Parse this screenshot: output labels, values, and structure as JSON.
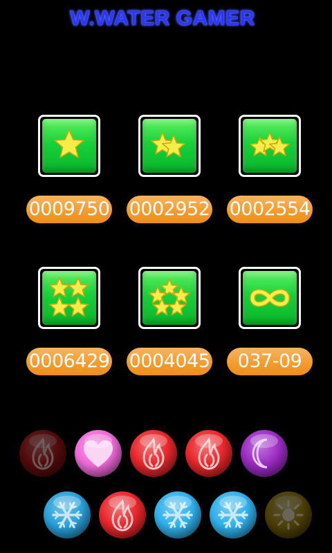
{
  "title": "W.WATER GAMER",
  "modes": [
    {
      "icon": "one-star-icon",
      "score": "0009750"
    },
    {
      "icon": "two-stars-icon",
      "score": "0002952"
    },
    {
      "icon": "three-stars-icon",
      "score": "0002554"
    },
    {
      "icon": "four-stars-icon",
      "score": "0006429"
    },
    {
      "icon": "five-stars-icon",
      "score": "0004045"
    },
    {
      "icon": "infinity-icon",
      "score": "037-09"
    }
  ],
  "elements_row_1": [
    {
      "icon": "fire-icon",
      "state": "dim",
      "color": "#b8171a"
    },
    {
      "icon": "heart-icon",
      "state": "active",
      "color": "#f06ad8"
    },
    {
      "icon": "fire-icon",
      "state": "active",
      "color": "#e8262a"
    },
    {
      "icon": "fire-icon",
      "state": "active",
      "color": "#e8262a"
    },
    {
      "icon": "moon-icon",
      "state": "active",
      "color": "#9b2bc4"
    }
  ],
  "elements_row_2": [
    {
      "icon": "snowflake-icon",
      "state": "active",
      "color": "#2aa0d8"
    },
    {
      "icon": "fire-icon",
      "state": "active",
      "color": "#e8262a"
    },
    {
      "icon": "snowflake-icon",
      "state": "active",
      "color": "#2fb0ea"
    },
    {
      "icon": "snowflake-icon",
      "state": "active",
      "color": "#2fb0ea"
    },
    {
      "icon": "sun-icon",
      "state": "dim",
      "color": "#a88a10"
    }
  ]
}
